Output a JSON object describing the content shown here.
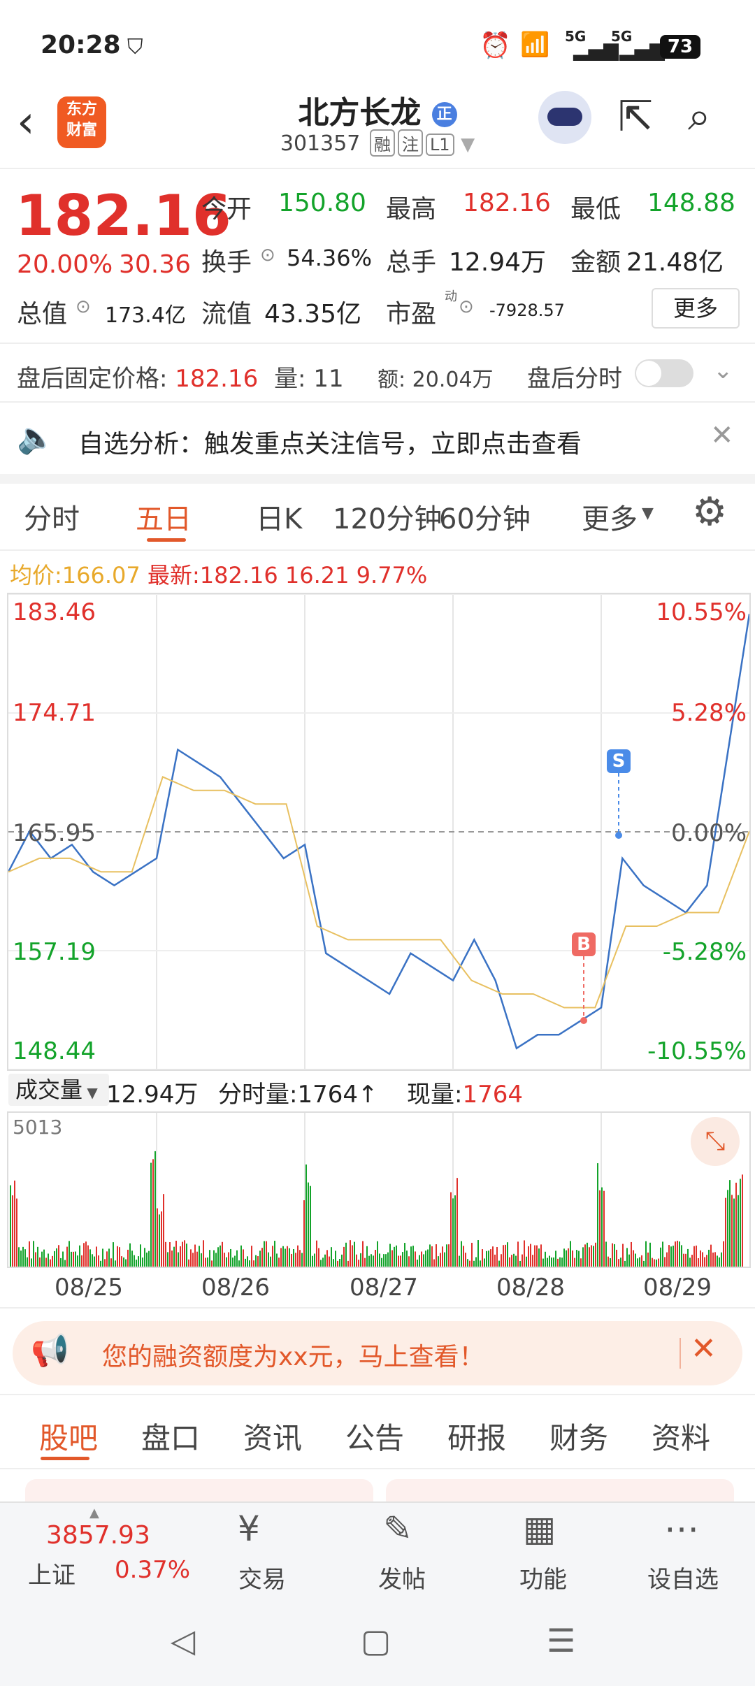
{
  "status_bar": {
    "time": "20:28",
    "battery": "73",
    "net1": "5G",
    "net2": "5G"
  },
  "header": {
    "brand": "东方\n财富",
    "title": "北方长龙",
    "code": "301357",
    "tags": [
      "融",
      "注",
      "L1"
    ]
  },
  "quote": {
    "price": "182.16",
    "change_pct": "20.00%",
    "change_amt": "30.36",
    "open_label": "今开",
    "open": "150.80",
    "high_label": "最高",
    "high": "182.16",
    "low_label": "最低",
    "low": "148.88",
    "turnover_label": "换手",
    "turnover": "54.36%",
    "volume_label": "总手",
    "volume": "12.94万",
    "amount_label": "金额",
    "amount": "21.48亿",
    "mktcap_label": "总值",
    "mktcap": "173.4亿",
    "float_label": "流值",
    "float": "43.35亿",
    "pe_label": "市盈",
    "pe_sup": "动",
    "pe": "-7928.57",
    "more_button": "更多"
  },
  "after_hours": {
    "label": "盘后固定价格:",
    "price": "182.16",
    "vol_label": "量:",
    "vol": "11",
    "amt_label": "额:",
    "amt": "20.04万",
    "toggle_label": "盘后分时"
  },
  "notice": {
    "text": "自选分析：触发重点关注信号，立即点击查看"
  },
  "tabs": [
    "分时",
    "五日",
    "日K",
    "120分钟",
    "60分钟",
    "更多"
  ],
  "active_tab": "五日",
  "chart_info": {
    "avg_label": "均价:",
    "avg": "166.07",
    "latest_label": "最新:",
    "latest": "182.16",
    "chg": "16.21",
    "pct": "9.77%"
  },
  "chart_data": {
    "type": "line",
    "x": [
      "08/25",
      "08/26",
      "08/27",
      "08/28",
      "08/29"
    ],
    "price_ticks": [
      "183.46",
      "174.71",
      "165.95",
      "157.19",
      "148.44"
    ],
    "pct_ticks": [
      "10.55%",
      "5.28%",
      "0.00%",
      "-5.28%",
      "-10.55%"
    ],
    "ylim": [
      148.44,
      183.46
    ],
    "series": [
      {
        "name": "",
        "values": [
          163,
          166,
          164,
          165,
          163,
          162,
          163,
          164,
          172,
          171,
          170,
          168,
          166,
          164,
          165,
          157,
          156,
          155,
          154,
          157,
          156,
          155,
          158,
          155,
          150,
          151,
          151,
          152,
          153,
          164,
          162,
          161,
          160,
          162,
          172,
          182
        ]
      },
      {
        "name": "",
        "values": [
          163,
          164,
          164,
          163,
          163,
          170,
          169,
          169,
          168,
          168,
          159,
          158,
          158,
          158,
          158,
          155,
          154,
          154,
          153,
          153,
          159,
          159,
          160,
          160,
          166
        ]
      }
    ],
    "markers": [
      {
        "label": "S"
      },
      {
        "label": "B"
      }
    ]
  },
  "volume_bar": {
    "label": "成交量",
    "total": "12.94万",
    "tick_label": "分时量:",
    "tick_value": "1764↑",
    "current_label": "现量:",
    "current_value": "1764",
    "max": "5013"
  },
  "promo": {
    "text": "您的融资额度为xx元，马上查看！"
  },
  "bottom_tabs": [
    "股吧",
    "盘口",
    "资讯",
    "公告",
    "研报",
    "财务",
    "资料"
  ],
  "bottom_nav": {
    "index_value": "3857.93",
    "index_name": "上证",
    "index_pct": "0.37%",
    "items": [
      "交易",
      "发帖",
      "功能",
      "设自选"
    ]
  }
}
